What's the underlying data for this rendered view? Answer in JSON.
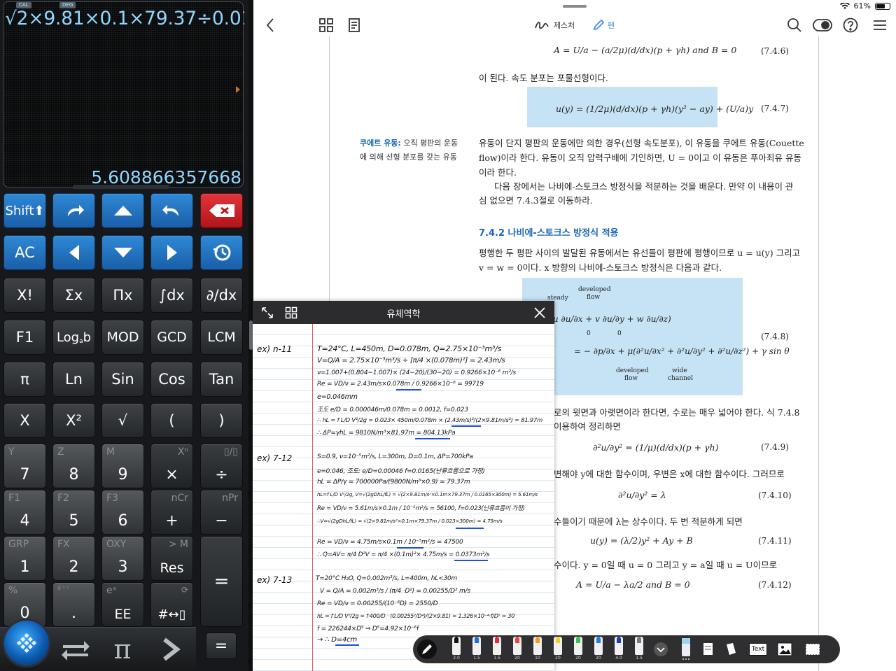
{
  "calculator": {
    "mode_tags": [
      "CAL",
      "DEG"
    ],
    "expression": "√2×9.81×0.1×79.37÷0.016",
    "result": "5.608866357668",
    "keys": {
      "shift": "Shift⬆",
      "ac": "AC",
      "factorial": "X!",
      "sum": "Σx",
      "product": "Πx",
      "integral": "∫dx",
      "derivative": "∂/dx",
      "f1": "F1",
      "logb": "Log",
      "logb_sub": "a",
      "logb_sub2": "b",
      "mod": "MOD",
      "gcd": "GCD",
      "lcm": "LCM",
      "pi": "π",
      "ln": "Ln",
      "sin": "Sin",
      "cos": "Cos",
      "tan": "Tan",
      "x": "X",
      "x2": "X²",
      "sqrt": "√",
      "lparen": "(",
      "rparen": ")",
      "n7": "7",
      "n7_sub": "Y",
      "n8": "8",
      "n8_sub": "Z",
      "n9": "9",
      "n9_sub": "M",
      "mul": "×",
      "mul_sub": "Xⁿ",
      "div": "÷",
      "div_sub": "▯/▯",
      "n4": "4",
      "n4_sub": "F1",
      "n5": "5",
      "n5_sub": "F2",
      "n6": "6",
      "n6_sub": "F3",
      "plus": "+",
      "plus_sub": "nCr",
      "minus": "−",
      "minus_sub": "nPr",
      "n1": "1",
      "n1_sub": "GRP",
      "n2": "2",
      "n2_sub": "FX",
      "n3": "3",
      "n3_sub": "OXY",
      "res": "Res",
      "res_sub": "> M",
      "n0": "0",
      "n0_sub": "%",
      "dot": ".",
      "dot_sub": "0 ⁿ ¹",
      "ee": "EE",
      "ee_sub": "eˣ",
      "convert": "#↔▯",
      "equals": "=",
      "equals_small": "=",
      "bottom_pi": "π"
    }
  },
  "viewer": {
    "status": {
      "battery": "61%"
    },
    "toolbar": {
      "eraser_label": "제스처",
      "pen_label": "펜"
    },
    "page": {
      "eq_746": "A = U/a − (a/2μ)(d/dx)(p + γh)   and   B = 0",
      "eq_746_no": "(7.4.6)",
      "text_1": "이 된다. 속도 분포는 포물선형이다.",
      "eq_747": "u(y) = (1/2μ)(d/dx)(p + γh)(y² − ay) + (U/a)y",
      "eq_747_no": "(7.4.7)",
      "side_title": "쿠에트 유동:",
      "side_rest1": " 오직 평판의 운동",
      "side_rest2": "에 의해 선형 분포를 갖는 유동",
      "para_1": "유동이 단지 평판의 운동에만 의한 경우(선형 속도분포), 이 유동을 쿠에트 유동(Couette",
      "para_2": "flow)이라 한다. 유동이 오직 압력구배에 기인하면, U = 0이고 이 유동은 푸아죄유 유동",
      "para_3": "이라 한다.",
      "para_4": "다음 장에서는 나비에-스토크스 방정식을 적분하는 것을 배운다. 만약 이 내용이 관",
      "para_5": "심 없으면 7.4.3절로 이동하라.",
      "section": "7.4.2  나비에-스토크스 방정식 적용",
      "para_6": "평행한 두 평판 사이의 발달된 유동에서는 유선들이 평판에 평행이므로 u = u(y) 그리고",
      "para_7": "v = w = 0이다. x 방향의 나비에-스토크스 방정식은 다음과 같다.",
      "box_developed": "developed",
      "box_flow": "flow",
      "box_steady": "steady",
      "box_eq1": "u ∂u/∂x + v ∂u/∂y + w ∂u/∂z)",
      "box_zero1": "0",
      "box_zero2": "0",
      "box_eq2": "= − ∂p/∂x + μ(∂²u/∂x² + ∂²u/∂y² + ∂²u/∂z²) + γ sin θ",
      "box_developed2": "developed",
      "box_flow2": "flow",
      "box_wide": "wide",
      "box_channel": "channel",
      "eq_748_no": "(7.4.8)",
      "para_8": "로의 윗면과 아랫면이라 한다면, 수로는 매우 넓어야 한다. 식 7.4.8",
      "para_9": "이용하여 정리하면",
      "eq_749": "∂²u/∂y² = (1/μ)(d/dx)(p + γh)",
      "eq_749_no": "(7.4.9)",
      "para_10": "변해야 y에 대한 함수이며, 우변은 x에 대한 함수이다. 그러므로",
      "eq_7410": "∂²u/∂y² = λ",
      "eq_7410_no": "(7.4.10)",
      "para_11": "수들이기 때문에 λ는 상수이다. 두 번 적분하게 되면",
      "eq_7411": "u(y) = (λ/2)y² + Ay + B",
      "eq_7411_no": "(7.4.11)",
      "para_12": "수이다. y = 0일 때 u = 0 그리고 y = a일 때 u = U이므로",
      "eq_7412": "A = U/a − λa/2     and     B = 0",
      "eq_7412_no": "(7.4.12)"
    }
  },
  "note": {
    "title": "유체역학",
    "ex1_label": "ex) n-11",
    "ex1_lines": [
      "T=24°C, L=450m, D=0.078m, Q=2.75×10⁻³m³/s",
      "V=Q/A = 2.75×10⁻³m³/s ÷ [π/4 ×(0.078m)²] = 2.43m/s",
      "ν=1.007+(0.804−1.007)× (24−20)/(30−20) = 0.9266×10⁻⁶ m²/s",
      "Re = VD/ν = 2.43m/s×0.078m / 0.9266×10⁻⁶ = 99719",
      "e=0.046mm",
      "조도 e/D = 0.000046m/0.078m = 0.0012, f=0.023",
      "∴ hL = f L/D V²/2g = 0.023× 450m/0.078m × (2.43m/s)²/(2×9.81m/s²) = 81.97m",
      "∴ ΔP=γhL = 9810N/m³×81.97m = 804.13kPa"
    ],
    "ex2_label": "ex) 7-12",
    "ex2_lines": [
      "S=0.9, ν=10⁻⁵m²/s, L=300m, D=0.1m, ΔP=700kPa",
      "e=0.046, 조도: e/D=0.00046 f=0.0165(난류흐름으로 가정)",
      "hL = ΔP/γ = 700000Pa/(9800N/m³×0.9) = 79.37m",
      "hL=f L/D V²/2g,  V=√(2gDhL/fL) = √(2×9.81m/s²×0.1m×79.37m / 0.0165×300m) = 5.61m/s",
      "Re = VD/ν = 5.61m/s×0.1m / 10⁻⁵m²/s = 56100, f=0.023(난류흐름이 가정)",
      "∴V=√(2gDhL/fL) = √(2×9.81m/s²×0.1m×79.37m / 0.023×300m) = 4.75m/s",
      "Re = VD/ν = 4.75m/s×0.1m / 10⁻⁵m²/s = 47500",
      "∴ Q=AV= π/4 D²V = π/4 ×(0.1m)²× 4.75m/s = 0.0373m³/s"
    ],
    "ex3_label": "ex) 7-13",
    "ex3_lines": [
      "T=20°C H₂O, Q=0.002m³/s, L=400m, hL<30m",
      "V = Q/A = 0.002m³/s / (π/4 ·D²) = 0.00255/D² m/s",
      "Re = VD/ν = 0.00255/(10⁻⁶D) = 2550/D",
      "hL = f L/D V²/2g = f·400/D · (0.00255²/D⁴)/(2×9.81) = 1.326×10⁻⁴·f/D⁵ = 30",
      "f = 226244×D⁵ ⇒ D⁵=4.92×10⁻⁶f",
      "→ ∴ D=4cm"
    ]
  },
  "pen_toolbar": {
    "pens": [
      {
        "size": "2.0",
        "color": "#111111"
      },
      {
        "size": "1.5",
        "color": "#1f6fe0"
      },
      {
        "size": "1.5",
        "color": "#e03030"
      },
      {
        "size": "20",
        "color": "#f04040"
      },
      {
        "size": "10",
        "color": "#f59a20"
      },
      {
        "size": "20",
        "color": "#f2d020"
      },
      {
        "size": "20",
        "color": "#3cc24a"
      },
      {
        "size": "20",
        "color": "#2a78e6"
      },
      {
        "size": "4.0",
        "color": "#1a3fb0"
      },
      {
        "size": "1.5",
        "color": "#7a7a7a"
      }
    ],
    "text_tool": "Text"
  }
}
